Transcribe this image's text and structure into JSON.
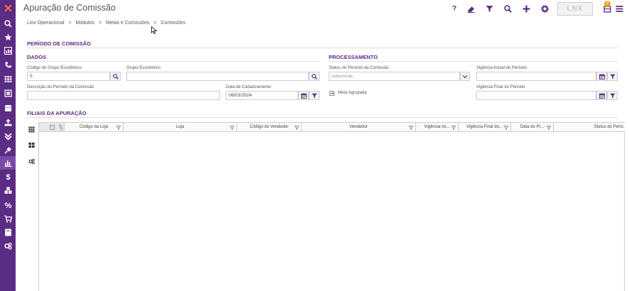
{
  "app": {
    "title": "Apuração de Comissão",
    "logo_text": "LNX",
    "notification_count": "0"
  },
  "breadcrumb": [
    "Linx Operacional",
    ">",
    "Módulos",
    ">",
    "Metas e Comissões",
    ">",
    "Comissões"
  ],
  "toolbar_icons": [
    "help-icon",
    "eraser-icon",
    "filter-icon",
    "search-icon",
    "add-icon",
    "settings-icon",
    "notification-icon",
    "menu-icon"
  ],
  "sidebar_icons": [
    "linx-logo-icon",
    "search-icon",
    "star-icon",
    "chart-icon",
    "phone-icon",
    "grid-icon",
    "image-icon",
    "store-icon",
    "upload-icon",
    "download-icon",
    "plug-icon",
    "bar-chart-icon",
    "dollar-icon",
    "cubes-icon",
    "percent-icon",
    "cart-icon",
    "book-icon",
    "cogs-icon"
  ],
  "form": {
    "section_title": "PERÍODO DE COMISSÃO",
    "dados": {
      "title": "DADOS",
      "codigo_grupo_label": "Código do Grupo Econômico",
      "codigo_grupo_value": "0",
      "grupo_label": "Grupo Econômico",
      "grupo_value": "",
      "descricao_label": "Descrição do Período da Comissão",
      "descricao_value": "",
      "data_cadastro_label": "Data de Cadastramento",
      "data_cadastro_value": "06/03/2024"
    },
    "processamento": {
      "title": "PROCESSAMENTO",
      "status_label": "Status do Período da Comissão",
      "status_placeholder": "selecionar...",
      "meta_agrupada_label": "Meta Agrupada",
      "vig_inicial_label": "Vigência Inicial do Período",
      "vig_inicial_value": "",
      "vig_final_label": "Vigência Final do Período",
      "vig_final_value": ""
    }
  },
  "filiais": {
    "title": "FILIAIS DA APURAÇÃO",
    "columns": [
      "Código da Loja",
      "Loja",
      "Código do Vendedor",
      "Vendedor",
      "Vigência Ini...",
      "Vigência Final do...",
      "Data do Pr...",
      "Status do Perío"
    ]
  },
  "colors": {
    "sidebar": "#5b2c83",
    "accent": "#5b2c83"
  }
}
